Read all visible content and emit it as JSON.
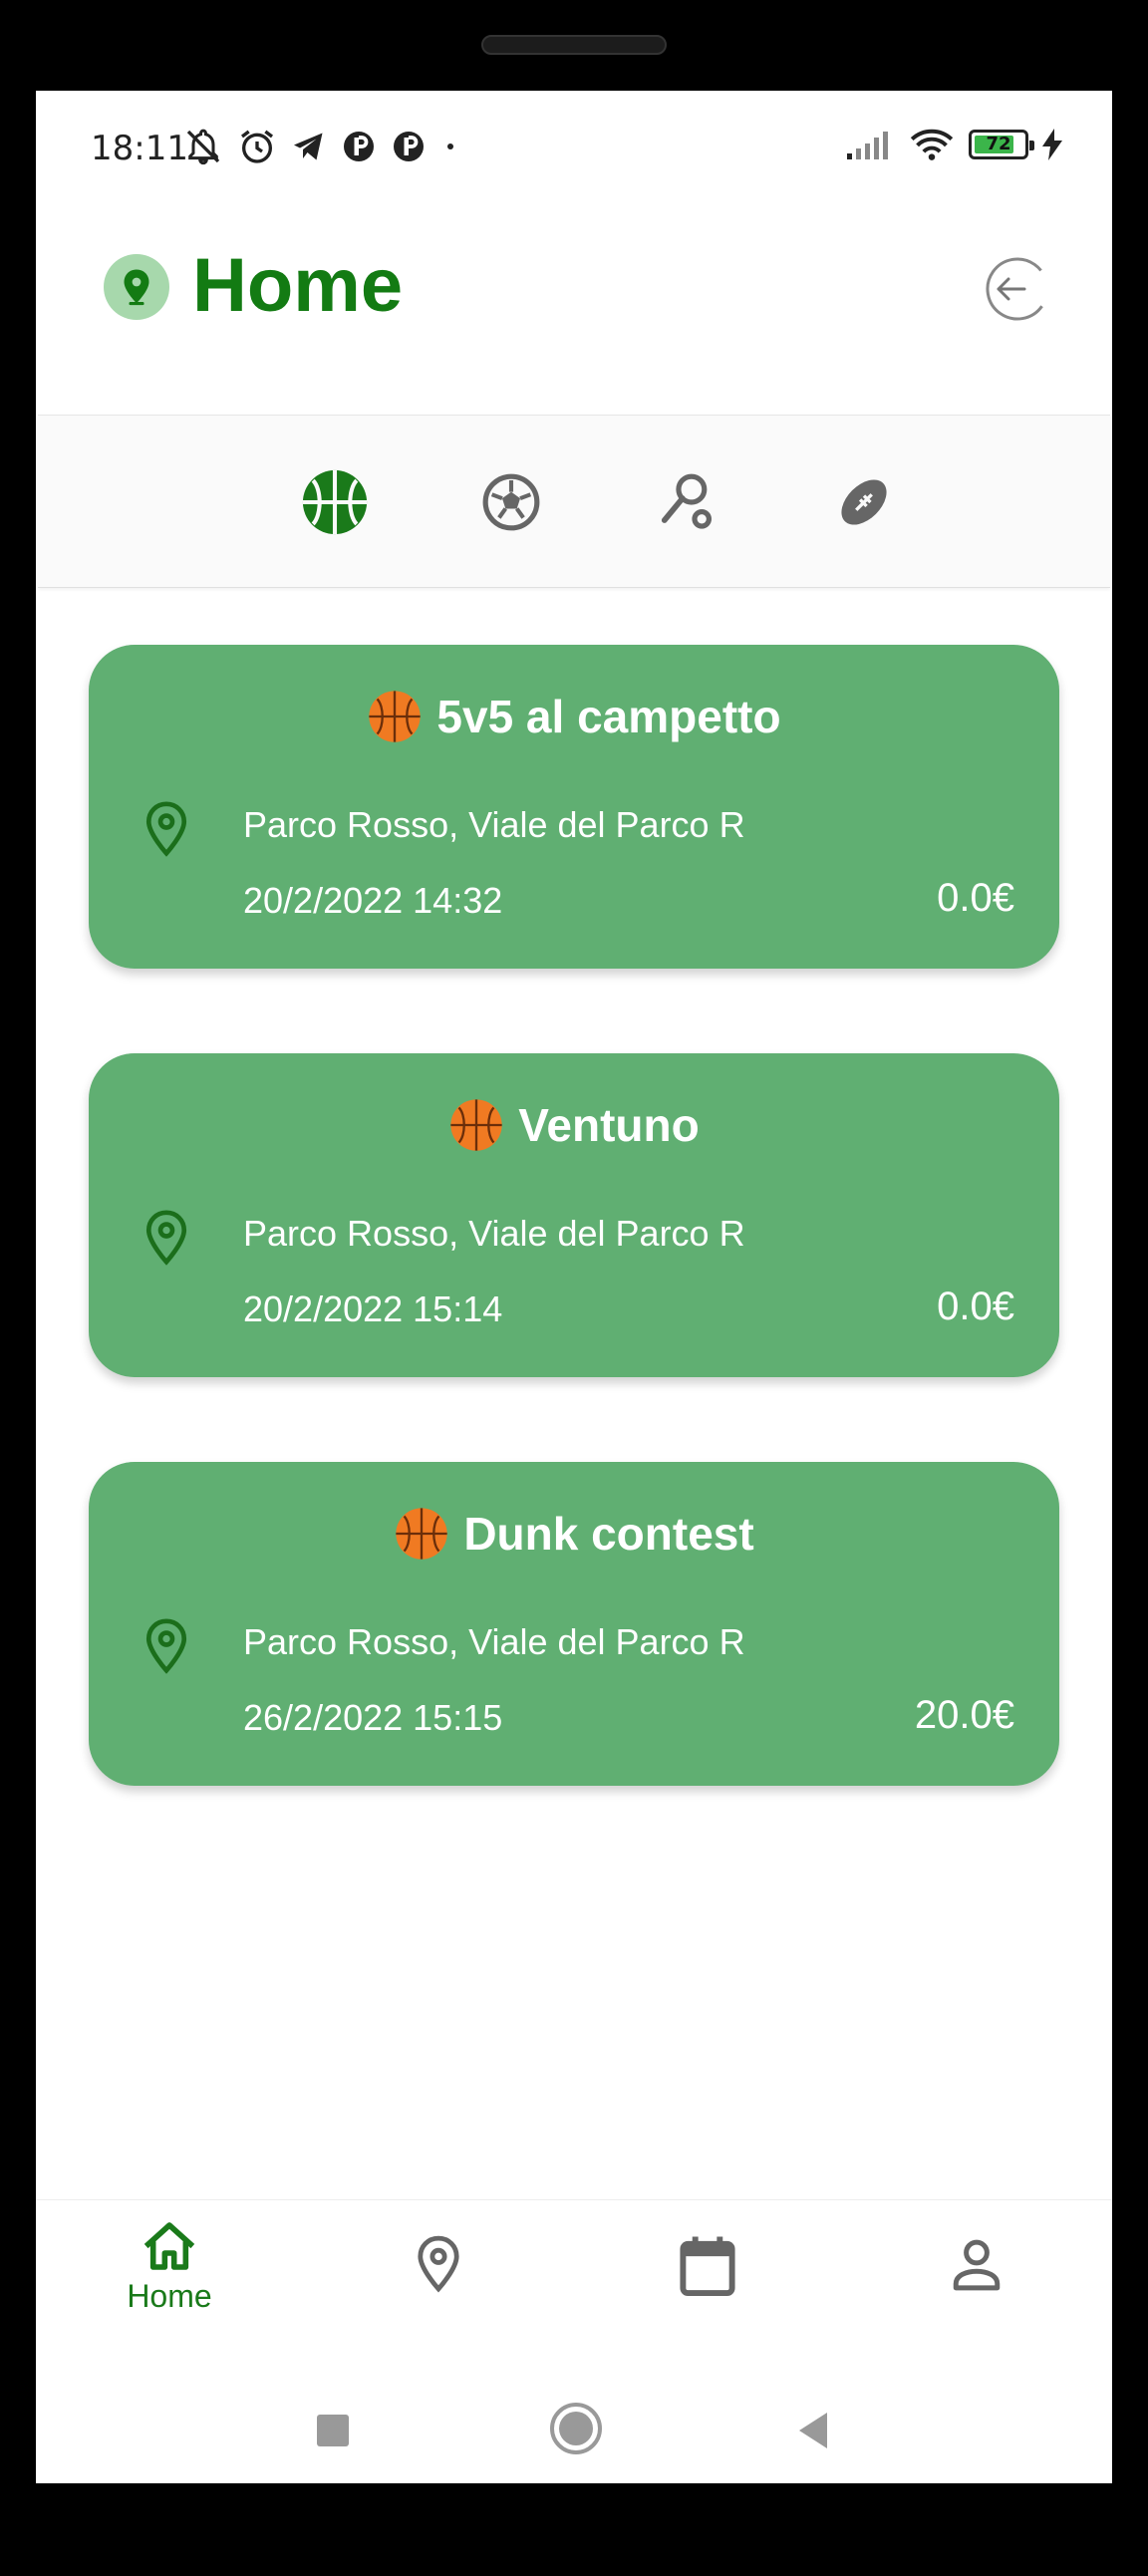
{
  "status_bar": {
    "time": "18:11",
    "battery": "72"
  },
  "header": {
    "title": "Home"
  },
  "sport_tabs": [
    {
      "name": "basketball",
      "icon": "basketball-icon",
      "active": true
    },
    {
      "name": "soccer",
      "icon": "soccer-ball-icon",
      "active": false
    },
    {
      "name": "tennis",
      "icon": "tennis-racket-icon",
      "active": false
    },
    {
      "name": "football",
      "icon": "american-football-icon",
      "active": false
    }
  ],
  "events": [
    {
      "title": "5v5 al campetto",
      "address": "Parco Rosso, Viale del Parco R",
      "datetime": "20/2/2022 14:32",
      "price": "0.0€"
    },
    {
      "title": "Ventuno",
      "address": "Parco Rosso, Viale del Parco R",
      "datetime": "20/2/2022 15:14",
      "price": "0.0€"
    },
    {
      "title": "Dunk contest",
      "address": "Parco Rosso, Viale del Parco R",
      "datetime": "26/2/2022 15:15",
      "price": "20.0€"
    }
  ],
  "bottom_nav": {
    "home_label": "Home",
    "items": [
      "home-icon",
      "map-pin-icon",
      "calendar-icon",
      "person-icon"
    ]
  },
  "colors": {
    "accent": "#137b13",
    "card": "#60af72",
    "active_tab": "#1a7a1a"
  }
}
